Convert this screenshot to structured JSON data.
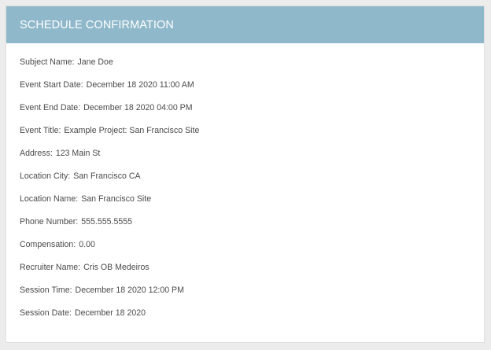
{
  "header": {
    "title": "SCHEDULE CONFIRMATION",
    "background_color": "#8fb8ca"
  },
  "details": [
    {
      "label": "Subject Name:",
      "value": "Jane Doe"
    },
    {
      "label": "Event Start Date:",
      "value": "December 18 2020 11:00 AM"
    },
    {
      "label": "Event End Date:",
      "value": "December 18 2020 04:00 PM"
    },
    {
      "label": "Event Title:",
      "value": "Example Project: San Francisco Site"
    },
    {
      "label": "Address:",
      "value": "123 Main St"
    },
    {
      "label": "Location City:",
      "value": "San Francisco CA"
    },
    {
      "label": "Location Name:",
      "value": "San Francisco Site"
    },
    {
      "label": "Phone Number:",
      "value": "555.555.5555"
    },
    {
      "label": "Compensation:",
      "value": "0.00"
    },
    {
      "label": "Recruiter Name:",
      "value": "Cris OB Medeiros"
    },
    {
      "label": "Session Time:",
      "value": "December 18 2020 12:00 PM"
    },
    {
      "label": "Session Date:",
      "value": "December 18 2020"
    }
  ]
}
